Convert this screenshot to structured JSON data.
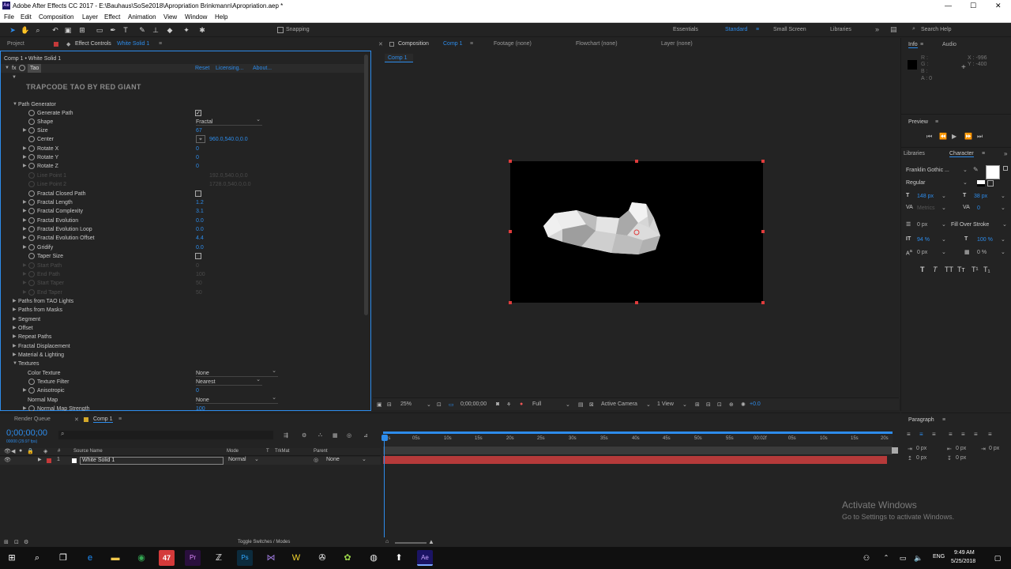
{
  "window": {
    "title": "Adobe After Effects CC 2017 - E:\\Bauhaus\\SoSe2018\\Apropriation Brinkmann\\Apropriation.aep *",
    "app_icon": "Ae",
    "controls": {
      "minimize": "—",
      "maximize": "☐",
      "close": "✕"
    }
  },
  "menu": [
    "File",
    "Edit",
    "Composition",
    "Layer",
    "Effect",
    "Animation",
    "View",
    "Window",
    "Help"
  ],
  "toolbar": {
    "tools": [
      "selection-tool",
      "hand-tool",
      "zoom-tool",
      "rotate-tool",
      "camera-tool",
      "pan-behind-tool",
      "rectangle-tool",
      "pen-tool",
      "type-tool",
      "brush-tool",
      "clone-stamp-tool",
      "eraser-tool",
      "roto-brush-tool",
      "puppet-tool"
    ],
    "snapping_label": "Snapping",
    "workspaces": [
      "Essentials",
      "Standard",
      "Small Screen",
      "Libraries"
    ],
    "active_workspace": "Standard",
    "search_placeholder": "Search Help"
  },
  "left_panel": {
    "tabs": {
      "project": "Project",
      "effect_controls_prefix": "Effect Controls",
      "effect_controls_layer": "White Solid 1"
    },
    "breadcrumb": "Comp 1 • White Solid 1",
    "effect_name": "Tao",
    "effect_links": {
      "reset": "Reset",
      "licensing": "Licensing...",
      "about": "About..."
    },
    "brand": "TRAPCODE TAO BY RED GIANT",
    "path_generator": "Path Generator",
    "props": {
      "generate_path": "Generate Path",
      "shape": "Shape",
      "shape_value": "Fractal",
      "size": "Size",
      "size_value": "67",
      "center": "Center",
      "center_value": "960.0,540.0,0.0",
      "rotate_x": "Rotate X",
      "rotate_x_value": "0",
      "rotate_y": "Rotate Y",
      "rotate_y_value": "0",
      "rotate_z": "Rotate Z",
      "rotate_z_value": "0",
      "line_point_1": "Line Point 1",
      "line_point_1_value": "192.0,540.0,0.0",
      "line_point_2": "Line Point 2",
      "line_point_2_value": "1728.0,540.0,0.0",
      "fractal_closed_path": "Fractal Closed Path",
      "fractal_length": "Fractal Length",
      "fractal_length_value": "1.2",
      "fractal_complexity": "Fractal Complexity",
      "fractal_complexity_value": "3.1",
      "fractal_evolution": "Fractal Evolution",
      "fractal_evolution_value": "0.0",
      "fractal_evolution_loop": "Fractal Evolution Loop",
      "fractal_evolution_loop_value": "0.0",
      "fractal_evolution_offset": "Fractal Evolution Offset",
      "fractal_evolution_offset_value": "4.4",
      "gridify": "Gridify",
      "gridify_value": "0.0",
      "taper_size": "Taper Size",
      "start_path": "Start Path",
      "start_path_value": "0",
      "end_path": "End Path",
      "end_path_value": "100",
      "start_taper": "Start Taper",
      "start_taper_value": "50",
      "end_taper": "End Taper",
      "end_taper_value": "50"
    },
    "groups": {
      "paths_from_tao_lights": "Paths from TAO Lights",
      "paths_from_masks": "Paths from Masks",
      "segment": "Segment",
      "offset": "Offset",
      "repeat_paths": "Repeat Paths",
      "fractal_displacement": "Fractal Displacement",
      "material_lighting": "Material & Lighting",
      "textures": "Textures"
    },
    "textures": {
      "color_texture": "Color Texture",
      "color_texture_value": "None",
      "texture_filter": "Texture Filter",
      "texture_filter_value": "Nearest",
      "anisotropic": "Anisotropic",
      "anisotropic_value": "0",
      "normal_map": "Normal Map",
      "normal_map_value": "None",
      "normal_map_strength": "Normal Map Strength",
      "normal_map_strength_value": "100"
    }
  },
  "viewer": {
    "tabs": {
      "composition_prefix": "Composition",
      "composition_name": "Comp 1",
      "footage": "Footage (none)",
      "flowchart": "Flowchart (none)",
      "layer": "Layer (none)"
    },
    "comp_tab": "Comp 1",
    "bottom": {
      "zoom": "25%",
      "timecode": "0;00;00;00",
      "resolution": "Full",
      "camera": "Active Camera",
      "views": "1 View",
      "exposure": "+0.0"
    }
  },
  "right_panel": {
    "info_tab": "Info",
    "audio_tab": "Audio",
    "info": {
      "r": "R :",
      "g": "G :",
      "b": "B :",
      "a": "A : 0",
      "x": "X : -996",
      "y": "Y : -400"
    },
    "preview_tab": "Preview",
    "libraries_tab": "Libraries",
    "character_tab": "Character",
    "character": {
      "font": "Franklin Gothic ...",
      "style": "Regular",
      "size": "148 px",
      "leading": "38 px",
      "kerning": "Metrics",
      "tracking": "0",
      "stroke_width": "0 px",
      "stroke_mode": "Fill Over Stroke",
      "vscale": "94 %",
      "hscale": "100 %",
      "baseline": "0 px",
      "tsume": "0 %",
      "type_styles": [
        "T",
        "T",
        "TT",
        "Tт",
        "T¹",
        "T₁"
      ]
    },
    "paragraph_tab": "Paragraph",
    "paragraph": {
      "indent_left": "0 px",
      "indent_right": "0 px",
      "indent_first": "0 px",
      "space_before": "0 px",
      "space_after": "0 px"
    }
  },
  "timeline": {
    "render_queue_tab": "Render Queue",
    "comp_tab": "Comp 1",
    "timecode": "0;00;00;00",
    "fps": "00000 (29.97 fps)",
    "columns": {
      "source_name": "Source Name",
      "mode": "Mode",
      "t": "T",
      "trkmat": "TrkMat",
      "parent": "Parent"
    },
    "layer": {
      "number": "1",
      "name": "White Solid 1",
      "mode": "Normal",
      "parent": "None"
    },
    "ruler": [
      "0s",
      "05s",
      "10s",
      "15s",
      "20s",
      "25s",
      "30s",
      "35s",
      "40s",
      "45s",
      "50s",
      "55s",
      "00:02f",
      "05s",
      "10s",
      "15s",
      "20s"
    ],
    "toggle_label": "Toggle Switches / Modes"
  },
  "watermark": {
    "line1": "Activate Windows",
    "line2": "Go to Settings to activate Windows."
  },
  "taskbar": {
    "time": "9:49 AM",
    "date": "5/25/2018",
    "lang": "ENG",
    "apps": [
      "windows-start-icon",
      "search-icon",
      "task-view-icon",
      "edge-icon",
      "file-explorer-icon",
      "chrome-icon",
      "app-47-icon",
      "premiere-icon",
      "app-z-icon",
      "photoshop-icon",
      "app-vs-icon",
      "app-w-icon",
      "app-gear-icon",
      "app-green-icon",
      "app-circle-icon",
      "app-up-icon",
      "after-effects-icon"
    ]
  },
  "colors": {
    "accent": "#2d8ceb",
    "layer_bar": "#b63a3a",
    "handle": "#e03c3c"
  }
}
